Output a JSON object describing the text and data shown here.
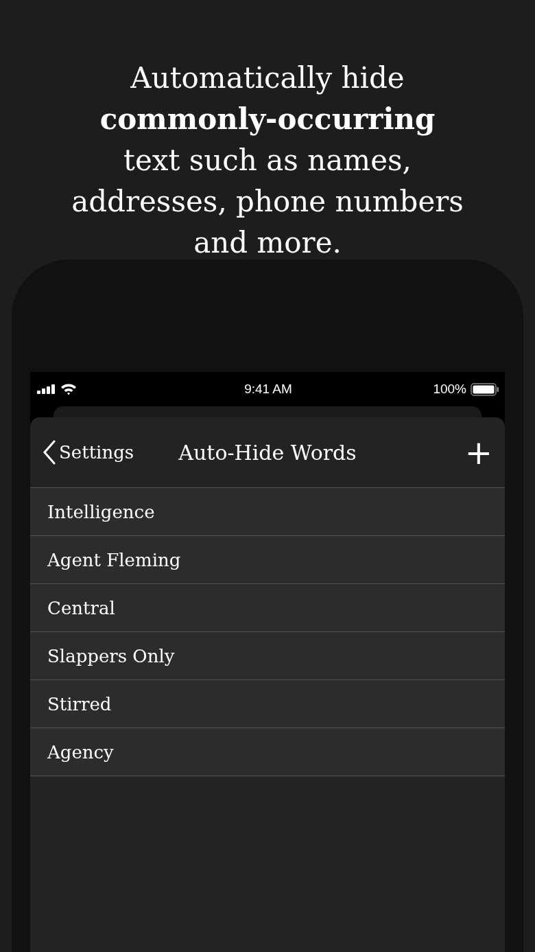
{
  "headline": "Automatically hide **commonly-occurring** text such as names, addresses, phone numbers and more.",
  "status_bar": {
    "time": "9:41 AM",
    "battery": "100%"
  },
  "nav_bar": {
    "back": "Settings",
    "title": "Auto-Hide Words",
    "add": "+"
  },
  "words": [
    {
      "text": "Intelligence"
    },
    {
      "text": "Agent Fleming"
    },
    {
      "text": "Central"
    },
    {
      "text": "Slappers Only"
    },
    {
      "text": "Stirred"
    },
    {
      "text": "Agency"
    }
  ]
}
